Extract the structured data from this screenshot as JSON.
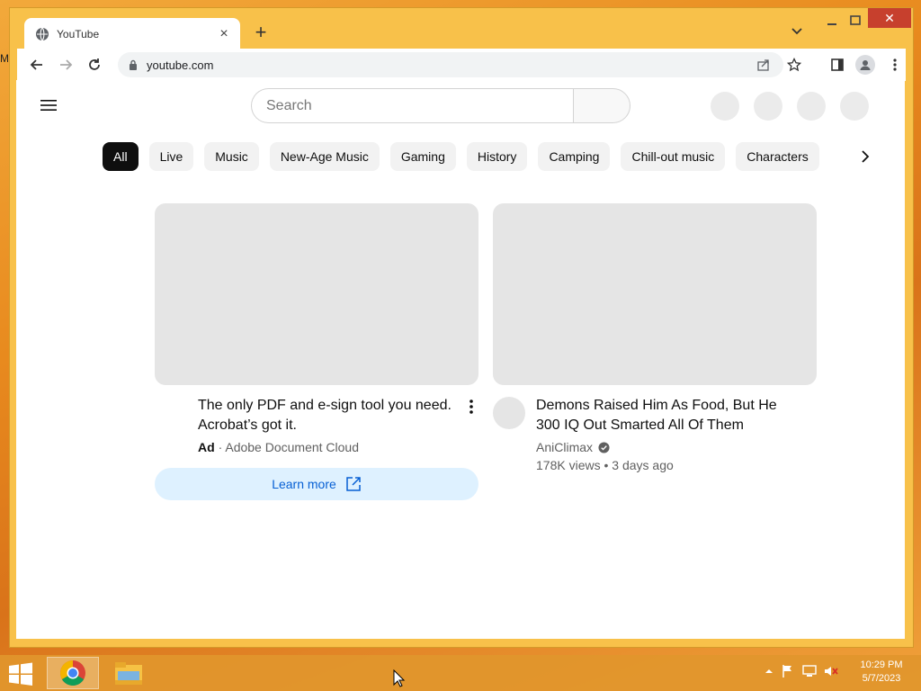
{
  "desktop": {
    "stray_text": "M"
  },
  "browser": {
    "tab_title": "YouTube",
    "url": "youtube.com",
    "new_tab_label": "+",
    "close_symbol": "×"
  },
  "youtube": {
    "search_placeholder": "Search",
    "chips": [
      "All",
      "Live",
      "Music",
      "New-Age Music",
      "Gaming",
      "History",
      "Camping",
      "Chill-out music",
      "Characters"
    ],
    "ad_card": {
      "title_line1": "The only PDF and e-sign tool you need.",
      "title_line2": "Acrobat’s got it.",
      "ad_label": "Ad",
      "separator": "·",
      "advertiser": "Adobe Document Cloud",
      "cta": "Learn more"
    },
    "video_card": {
      "title_line1": "Demons Raised Him As Food, But He",
      "title_line2": "300 IQ Out Smarted All Of Them",
      "channel": "AniClimax",
      "stats": "178K views • 3 days ago"
    }
  },
  "taskbar": {
    "time": "10:29 PM",
    "date": "5/7/2023"
  },
  "colors": {
    "accent_blue": "#065fd4",
    "close_red": "#c7402d",
    "frame": "#f8c14a"
  }
}
